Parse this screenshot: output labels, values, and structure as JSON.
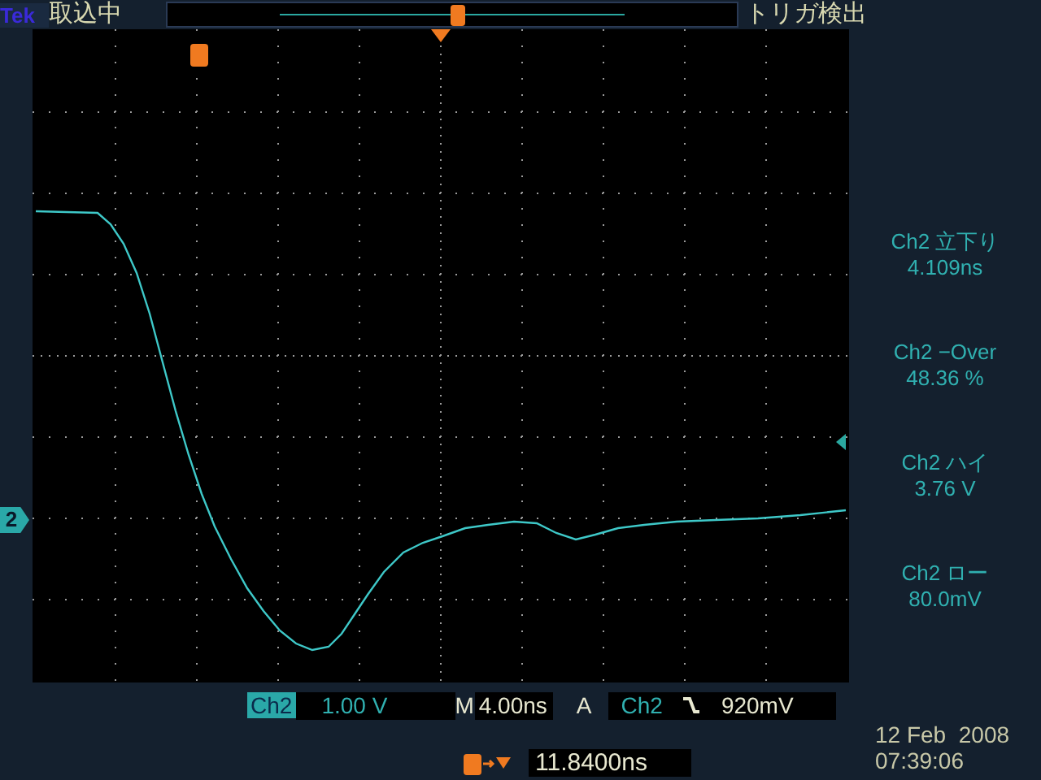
{
  "header": {
    "logo": "Tek",
    "acquisition_status": "取込中",
    "trigger_status": "トリガ検出"
  },
  "channel_marker": "2",
  "measurements": [
    {
      "label": "Ch2 立下り",
      "value": "4.109ns"
    },
    {
      "label": "Ch2 −Over",
      "value": "48.36 %"
    },
    {
      "label": "Ch2 ハイ",
      "value": "3.76 V"
    },
    {
      "label": "Ch2 ロー",
      "value": "80.0mV"
    }
  ],
  "readouts": {
    "channel": "Ch2",
    "scale": "1.00 V",
    "timebase_label": "M",
    "timebase": "4.00ns",
    "trigger_mode": "A",
    "trigger_source": "Ch2",
    "trigger_level": "920mV"
  },
  "trigger_position": "11.8400ns",
  "date": "12 Feb  2008",
  "time": "07:39:06"
}
